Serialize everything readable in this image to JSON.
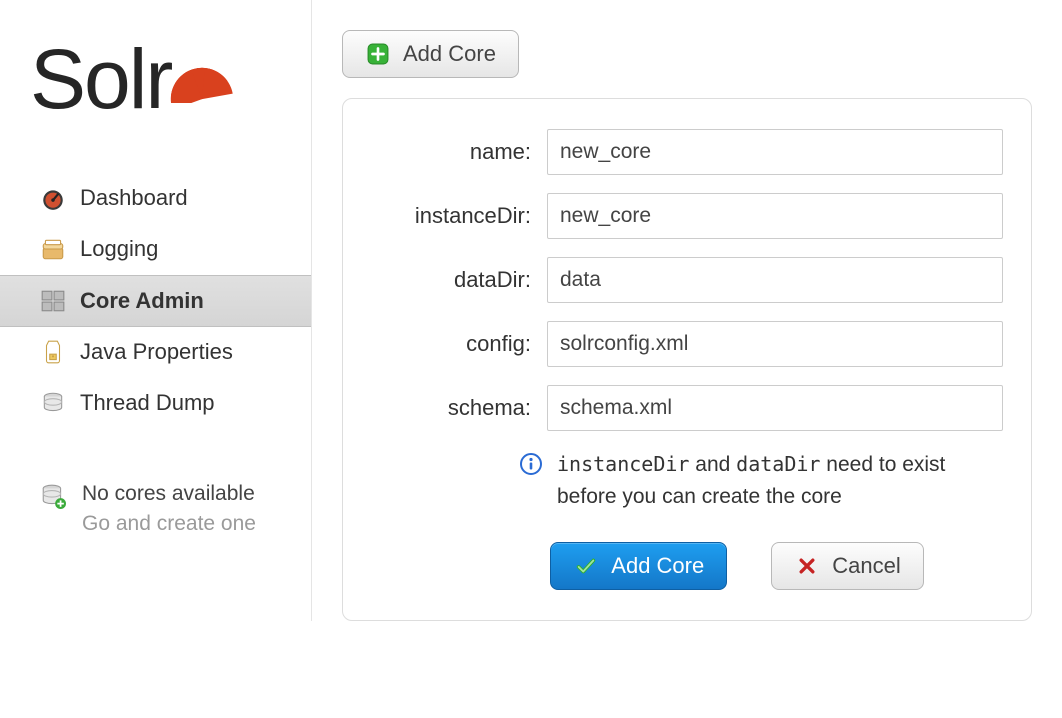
{
  "logo": {
    "text": "Solr"
  },
  "nav": {
    "items": [
      {
        "label": "Dashboard"
      },
      {
        "label": "Logging"
      },
      {
        "label": "Core Admin"
      },
      {
        "label": "Java Properties"
      },
      {
        "label": "Thread Dump"
      }
    ]
  },
  "core_status": {
    "title": "No cores available",
    "sub": "Go and create one"
  },
  "toolbar": {
    "add_core_label": "Add Core"
  },
  "form": {
    "fields": {
      "name": {
        "label": "name:",
        "value": "new_core"
      },
      "instanceDir": {
        "label": "instanceDir:",
        "value": "new_core"
      },
      "dataDir": {
        "label": "dataDir:",
        "value": "data"
      },
      "config": {
        "label": "config:",
        "value": "solrconfig.xml"
      },
      "schema": {
        "label": "schema:",
        "value": "schema.xml"
      }
    },
    "info": {
      "code1": "instanceDir",
      "mid": " and ",
      "code2": "dataDir",
      "rest": " need to exist before you can create the core"
    },
    "actions": {
      "submit": "Add Core",
      "cancel": "Cancel"
    }
  }
}
